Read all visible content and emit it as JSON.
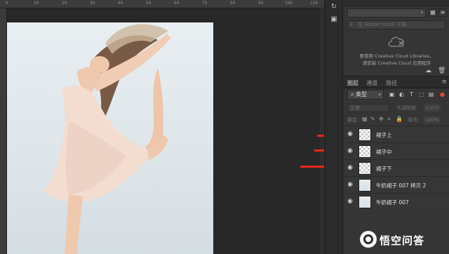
{
  "ruler": {
    "ticks": [
      "0",
      "10",
      "20",
      "30",
      "40",
      "50",
      "60",
      "70",
      "80",
      "90",
      "100",
      "110"
    ]
  },
  "libraries": {
    "search_placeholder": "在 Adobe Stock 中搜",
    "message_line1": "要使用 Creative Cloud Libraries，",
    "message_line2": "请安装 Creative Cloud 应用程序"
  },
  "layers_panel": {
    "tabs": [
      "图层",
      "通道",
      "路径"
    ],
    "filter_label": "类型",
    "blend_mode": "正常",
    "opacity_label": "不透明度:",
    "opacity_value": "100%",
    "lock_label": "锁定:",
    "fill_label": "填充:",
    "fill_value": "100%",
    "layers": [
      {
        "name": "裙子上",
        "thumb": "transparent"
      },
      {
        "name": "裙子中",
        "thumb": "transparent"
      },
      {
        "name": "裙子下",
        "thumb": "transparent"
      },
      {
        "name": "牛奶裙子 007 拷贝 2",
        "thumb": "photo"
      },
      {
        "name": "牛奶裙子 007",
        "thumb": "photo"
      }
    ]
  },
  "watermark": {
    "text": "悟空问答"
  },
  "colors": {
    "arrow": "#e8261a",
    "panel_bg": "#353535",
    "canvas_bg": "#282828"
  }
}
